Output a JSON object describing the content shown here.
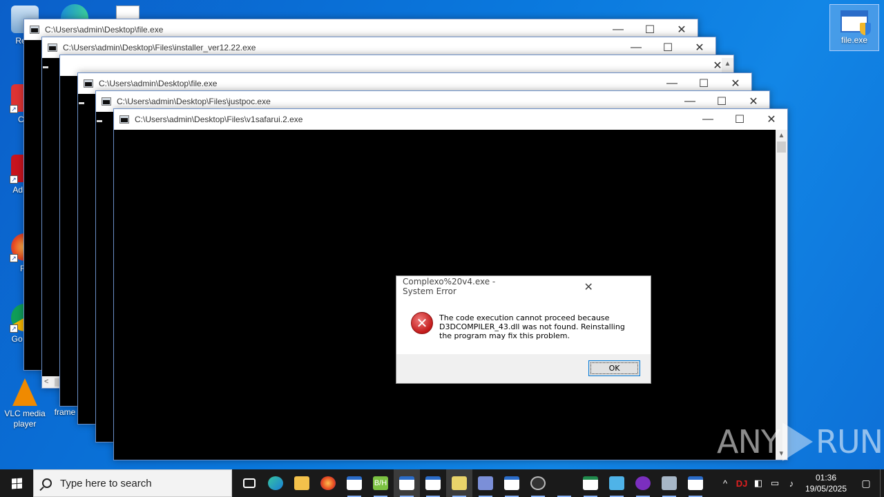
{
  "desktop": {
    "icons": [
      {
        "label": "Recy",
        "icon": "recycle-bin-icon"
      },
      {
        "label": "CCl",
        "icon": "ccleaner-icon"
      },
      {
        "label": "Ad Acr",
        "icon": "adobe-acrobat-icon"
      },
      {
        "label": "Fir",
        "icon": "firefox-icon"
      },
      {
        "label": "Go Chr",
        "icon": "chrome-icon"
      },
      {
        "label": "VLC media player",
        "icon": "vlc-icon"
      },
      {
        "label": "frame",
        "icon": "file-icon"
      }
    ],
    "selected_icon": {
      "label": "file.exe",
      "icon": "application-shield-icon"
    }
  },
  "windows": [
    {
      "title": "C:\\Users\\admin\\Desktop\\file.exe"
    },
    {
      "title": "C:\\Users\\admin\\Desktop\\Files\\installer_ver12.22.exe"
    },
    {
      "title": ""
    },
    {
      "title": "C:\\Users\\admin\\Desktop\\file.exe"
    },
    {
      "title": "C:\\Users\\admin\\Desktop\\Files\\justpoc.exe"
    },
    {
      "title": "C:\\Users\\admin\\Desktop\\Files\\v1safarui.2.exe"
    }
  ],
  "window_controls": {
    "minimize": "—",
    "maximize": "☐",
    "close": "✕"
  },
  "dialog": {
    "title": "Complexo%20v4.exe - System Error",
    "message": "The code execution cannot proceed because D3DCOMPILER_43.dll was not found. Reinstalling the program may fix this problem.",
    "ok_label": "OK",
    "close_glyph": "✕",
    "icon": "error-icon"
  },
  "watermark": {
    "left": "ANY",
    "right": "RUN"
  },
  "taskbar": {
    "search_placeholder": "Type here to search",
    "apps": [
      "task-view-icon",
      "edge-icon",
      "file-explorer-icon",
      "firefox-icon",
      "console-icon",
      "bh-icon",
      "console-icon",
      "console-icon",
      "game-icon",
      "network-tool-icon",
      "console-icon",
      "link-icon",
      "package-icon",
      "window-icon",
      "monitor-icon",
      "purple-app-icon",
      "installer-icon",
      "console-icon"
    ],
    "tray": {
      "chevron": "^",
      "dj": "DJ",
      "clock_time": "01:36",
      "clock_date": "19/05/2025"
    }
  },
  "colors": {
    "desktop": "#0a78dd",
    "taskbar": "#1a1a1a",
    "error_red": "#c21a1a",
    "ok_border": "#0078d7"
  }
}
